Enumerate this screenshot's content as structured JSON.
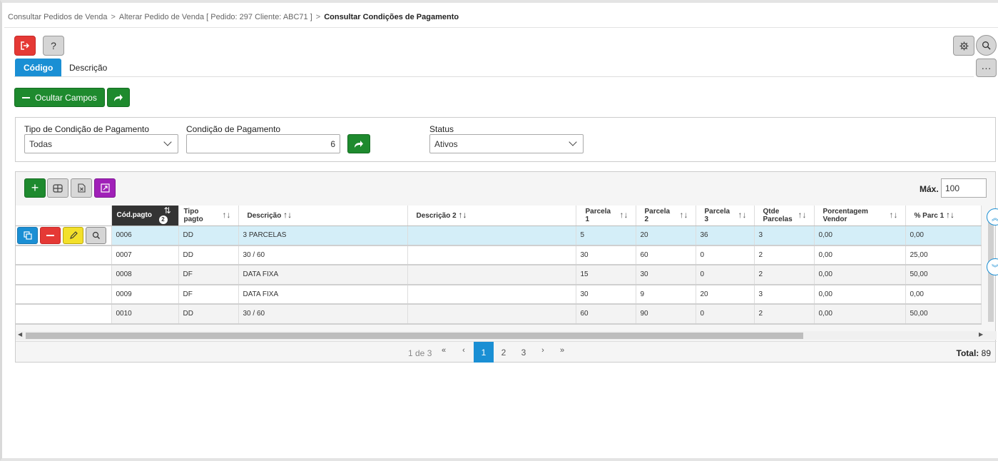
{
  "breadcrumb": {
    "item1": "Consultar Pedidos de Venda",
    "item2": "Alterar Pedido de Venda [ Pedido: 297 Cliente: ABC71 ]",
    "current": "Consultar Condições de Pagamento",
    "separator": ">"
  },
  "toolbar": {
    "help_label": "?",
    "tabs": [
      {
        "label": "Código",
        "active": true
      },
      {
        "label": "Descrição",
        "active": false
      }
    ],
    "hide_fields_label": "Ocultar Campos",
    "more_label": "···"
  },
  "filters": {
    "tipo_label": "Tipo de Condição de Pagamento",
    "tipo_value": "Todas",
    "condicao_label": "Condição de Pagamento",
    "condicao_value": "6",
    "status_label": "Status",
    "status_value": "Ativos"
  },
  "grid": {
    "max_label": "Máx.",
    "max_value": "100",
    "columns": [
      {
        "label": "Cód.pagto",
        "sort": "⇅",
        "active": true,
        "badge": "2"
      },
      {
        "label": "Tipo pagto",
        "sort": "↑↓"
      },
      {
        "label": "Descrição",
        "sort": "↑↓"
      },
      {
        "label": "Descrição 2",
        "sort": "↑↓"
      },
      {
        "label": "Parcela 1",
        "sort": "↑↓"
      },
      {
        "label": "Parcela 2",
        "sort": "↑↓"
      },
      {
        "label": "Parcela 3",
        "sort": "↑↓"
      },
      {
        "label": "Qtde Parcelas",
        "sort": "↑↓"
      },
      {
        "label": "Porcentagem Vendor",
        "sort": "↑↓"
      },
      {
        "label": "% Parc 1",
        "sort": "↑↓"
      }
    ],
    "rows": [
      [
        "0006",
        "DD",
        "3 PARCELAS",
        "",
        "5",
        "20",
        "36",
        "3",
        "0,00",
        "0,00"
      ],
      [
        "0007",
        "DD",
        "30 / 60",
        "",
        "30",
        "60",
        "0",
        "2",
        "0,00",
        "25,00"
      ],
      [
        "0008",
        "DF",
        "DATA FIXA",
        "",
        "15",
        "30",
        "0",
        "2",
        "0,00",
        "50,00"
      ],
      [
        "0009",
        "DF",
        "DATA FIXA",
        "",
        "30",
        "9",
        "20",
        "3",
        "0,00",
        "0,00"
      ],
      [
        "0010",
        "DD",
        "30 / 60",
        "",
        "60",
        "90",
        "0",
        "2",
        "0,00",
        "50,00"
      ]
    ]
  },
  "pager": {
    "info": "1 de 3",
    "pages": [
      "1",
      "2",
      "3"
    ],
    "current_page": "1",
    "first": "«",
    "prev": "‹",
    "next": "›",
    "last": "»",
    "total_label": "Total:",
    "total_value": "89"
  },
  "colors": {
    "primary": "#1a8fd4",
    "success": "#1e8a2e",
    "danger": "#e53935",
    "warning": "#f3e02a",
    "purple": "#a020b8",
    "selected_row": "#d4eef8"
  }
}
